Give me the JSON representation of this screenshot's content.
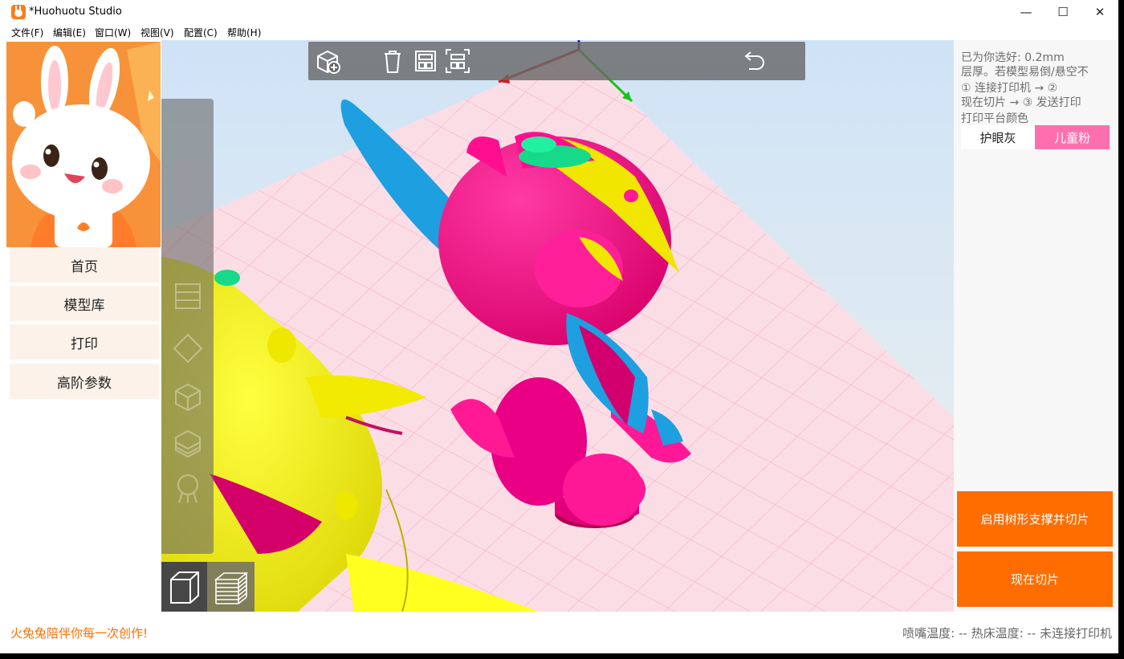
{
  "window": {
    "title": "*Huohuotu Studio",
    "controls": {
      "minimize": "—",
      "maximize": "☐",
      "close": "✕"
    }
  },
  "menu": [
    {
      "label": "文件(F)"
    },
    {
      "label": "编辑(E)"
    },
    {
      "label": "窗口(W)"
    },
    {
      "label": "视图(V)"
    },
    {
      "label": "配置(C)"
    },
    {
      "label": "帮助(H)"
    }
  ],
  "sidebar": {
    "mascot_icon": "bunny-mascot",
    "items": [
      {
        "label": "首页"
      },
      {
        "label": "模型库"
      },
      {
        "label": "打印"
      },
      {
        "label": "高阶参数"
      }
    ]
  },
  "viewport": {
    "top_toolbar": [
      "add-model-icon",
      "delete-icon",
      "arrange-icon",
      "fit-view-icon",
      "undo-icon"
    ],
    "side_toolbar": [
      "move-icon",
      "rotate-icon",
      "scale-icon",
      "mirror-icon",
      "cut-icon",
      "support-icon"
    ],
    "view_modes": [
      "solid-view-icon",
      "layer-view-icon"
    ],
    "bed_color": "#fbdde6",
    "models": [
      "yellow fish model",
      "pink cat model"
    ]
  },
  "right_panel": {
    "info_line1": "已为你选好: 0.2mm",
    "info_line2": "层厚。若模型易倒/悬空不",
    "info_line3": "① 连接打印机 → ②",
    "info_line4": "现在切片 → ③ 发送打印",
    "bed_color_label": "打印平台颜色",
    "swatch_grey": "护眼灰",
    "swatch_pink": "儿童粉",
    "tree_support_button": "启用树形支撑并切片",
    "slice_button": "现在切片",
    "accent_color": "#ff6d00",
    "pink_color": "#ff6fae"
  },
  "statusbar": {
    "slogan": "火兔兔陪伴你每一次创作!",
    "status": "喷嘴温度: --  热床温度: --  未连接打印机"
  }
}
